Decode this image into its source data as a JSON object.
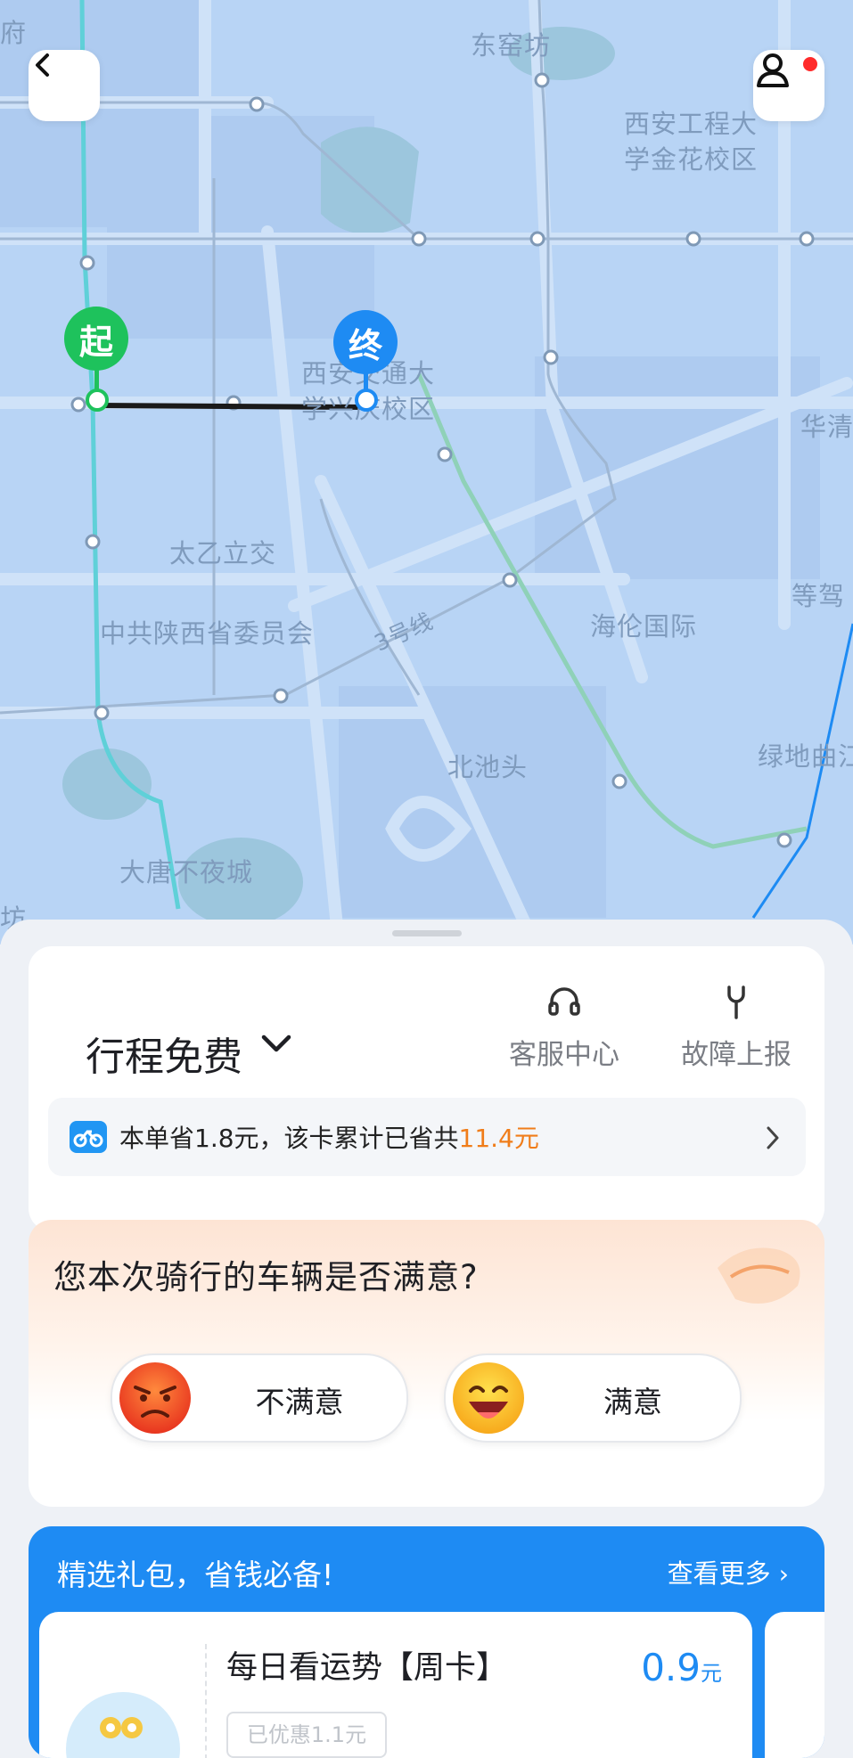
{
  "map": {
    "labels": {
      "fu": "府",
      "dongyaofang": "东窑坊",
      "xagc_1": "西安工程大",
      "xagc_2": "学金花校区",
      "jd_1": "西安交通大",
      "jd_2": "学兴庆校区",
      "huaqing": "华清",
      "taiyi": "太乙立交",
      "dengjia": "等驾",
      "zhonggong": "中共陕西省委员会",
      "line3": "3号线",
      "hailun": "海伦国际",
      "beichitou": "北池头",
      "lvdi": "绿地曲江",
      "datang": "大唐不夜城",
      "fang": "坊"
    },
    "start_marker": "起",
    "end_marker": "终",
    "back_icon": "chevron-left-icon",
    "profile_icon": "user-icon"
  },
  "trip": {
    "title": "行程免费",
    "service_label": "客服中心",
    "fault_label": "故障上报",
    "savings_prefix": "本单省1.8元，该卡累计已省共",
    "savings_amount": "11.4元"
  },
  "survey": {
    "question": "您本次骑行的车辆是否满意?",
    "unsatisfied": "不满意",
    "satisfied": "满意"
  },
  "gifts": {
    "title": "精选礼包，省钱必备!",
    "more": "查看更多",
    "item_name": "每日看运势【周卡】",
    "item_price": "0.9",
    "item_unit": "元",
    "item_tag": "已优惠1.1元"
  },
  "colors": {
    "map_bg": "#b8d4f5",
    "start_green": "#1ec25c",
    "end_blue": "#1e8bf3",
    "accent_orange": "#f07d1a",
    "gift_blue": "#1e8bf3"
  }
}
